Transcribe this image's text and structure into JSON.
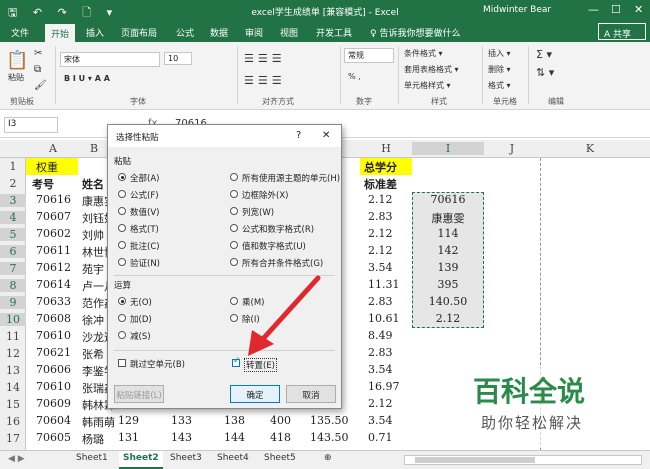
{
  "window": {
    "title": "excel学生成绩单 [兼容模式] - Excel",
    "user": "Midwinter Bear"
  },
  "qat": {
    "icons": "🖫 ↶ ↷ 🗋 ▾"
  },
  "tabs": [
    "文件",
    "开始",
    "插入",
    "页面布局",
    "公式",
    "数据",
    "审阅",
    "视图",
    "开发工具"
  ],
  "tell_me": "♀ 告诉我你想要做什么",
  "share": "A 共享",
  "ribbon": {
    "clipboard": "剪贴板",
    "paste": "粘贴",
    "font_group": "字体",
    "align_group": "对齐方式",
    "number_group": "数字",
    "style_group": "样式",
    "cells_group": "单元格",
    "edit_group": "编辑",
    "font_name": "宋体",
    "font_size": "10",
    "number_format": "常规",
    "cond_format": "条件格式 ▾",
    "table_format": "套用表格格式 ▾",
    "cell_style": "单元格样式 ▾",
    "insert": "插入 ▾",
    "delete": "删除 ▾",
    "format": "格式 ▾",
    "font_buttons": "B  I  U  ▾   A  A",
    "num_pct": "% ,"
  },
  "formula_bar": {
    "name_box": "I3",
    "formula": "70616"
  },
  "columns": [
    "A",
    "B",
    "H",
    "I",
    "J",
    "K"
  ],
  "rows": [
    "1",
    "2",
    "3",
    "4",
    "5",
    "6",
    "7",
    "8",
    "9",
    "10",
    "11",
    "12",
    "13",
    "14",
    "15",
    "16",
    "17"
  ],
  "sheet": {
    "a1": "权重",
    "a2": "考号",
    "b2": "姓名",
    "h1": "总学分",
    "h2": "标准差",
    "col_a": [
      "70616",
      "70607",
      "70602",
      "70611",
      "70612",
      "70614",
      "70633",
      "70608",
      "70610",
      "70621",
      "70606",
      "70610",
      "70609",
      "70604",
      "70605"
    ],
    "col_b": [
      "康惠实",
      "刘钰如",
      "刘帅",
      "林世博",
      "苑宇",
      "卢一凡",
      "范作鑫",
      "徐冲",
      "沙龙逸",
      "张希",
      "李鉴学",
      "张瑞鑫",
      "韩林霖",
      "韩雨萌",
      "杨璐"
    ],
    "col_h": [
      "2.12",
      "2.83",
      "2.12",
      "2.12",
      "3.54",
      "11.31",
      "2.83",
      "10.61",
      "8.49",
      "2.83",
      "3.54",
      "16.97",
      "2.12",
      "3.54",
      "0.71"
    ],
    "col_i": [
      "70616",
      "康惠雯",
      "114",
      "142",
      "139",
      "395",
      "140.50",
      "2.12"
    ],
    "row16": [
      "129",
      "133",
      "138",
      "400",
      "135.50"
    ],
    "row17": [
      "131",
      "143",
      "144",
      "418",
      "143.50"
    ]
  },
  "dialog": {
    "title": "选择性粘贴",
    "help": "?",
    "close": "✕",
    "paste_label": "粘贴",
    "paste_left": [
      "全部(A)",
      "公式(F)",
      "数值(V)",
      "格式(T)",
      "批注(C)",
      "验证(N)"
    ],
    "paste_right": [
      "所有使用源主题的单元(H)",
      "边框除外(X)",
      "列宽(W)",
      "公式和数字格式(R)",
      "值和数字格式(U)",
      "所有合并条件格式(G)"
    ],
    "op_label": "运算",
    "op_left": [
      "无(O)",
      "加(D)",
      "减(S)"
    ],
    "op_right": [
      "乘(M)",
      "除(I)"
    ],
    "skip_blanks": "跳过空单元(B)",
    "transpose": "转置(E)",
    "paste_link": "粘贴链接(L)",
    "ok": "确定",
    "cancel": "取消"
  },
  "sheets": [
    "Sheet1",
    "Sheet2",
    "Sheet3",
    "Sheet4",
    "Sheet5",
    "⊕"
  ],
  "watermark": {
    "title": "百科全说",
    "subtitle": "助你轻松解决"
  },
  "colors": {
    "brand": "#217346",
    "arrow": "#e0282e",
    "highlight": "#ffff00"
  }
}
